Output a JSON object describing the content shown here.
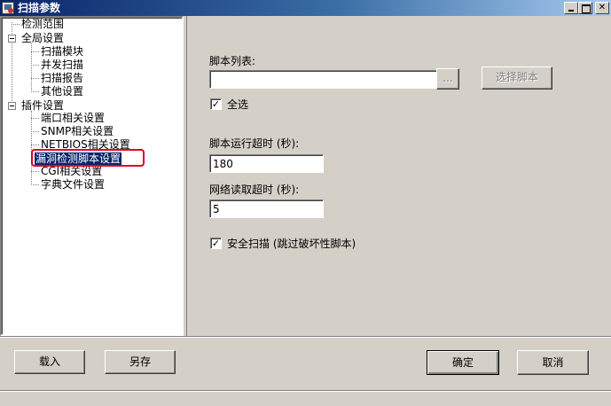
{
  "window": {
    "title": "扫描参数",
    "controls": [
      "minimize",
      "maximize",
      "close"
    ]
  },
  "tree": {
    "items": [
      {
        "label": "检测范围",
        "level": 0
      },
      {
        "label": "全局设置",
        "level": 0,
        "expanded": true
      },
      {
        "label": "扫描模块",
        "level": 1
      },
      {
        "label": "并发扫描",
        "level": 1
      },
      {
        "label": "扫描报告",
        "level": 1
      },
      {
        "label": "其他设置",
        "level": 1
      },
      {
        "label": "插件设置",
        "level": 0,
        "expanded": true
      },
      {
        "label": "端口相关设置",
        "level": 1
      },
      {
        "label": "SNMP相关设置",
        "level": 1
      },
      {
        "label": "NETBIOS相关设置",
        "level": 1
      },
      {
        "label": "漏洞检测脚本设置",
        "level": 1,
        "selected": true
      },
      {
        "label": "CGI相关设置",
        "level": 1
      },
      {
        "label": "字典文件设置",
        "level": 1
      }
    ]
  },
  "panel": {
    "script_list_label": "脚本列表:",
    "script_list_value": "",
    "browse_button": "...",
    "select_script_button": "选择脚本",
    "select_all_label": "全选",
    "select_all_checked": true,
    "script_timeout_label": "脚本运行超时 (秒):",
    "script_timeout_value": "180",
    "network_timeout_label": "网络读取超时 (秒):",
    "network_timeout_value": "5",
    "safe_scan_label": "安全扫描 (跳过破坏性脚本)",
    "safe_scan_checked": true
  },
  "footer": {
    "load_button": "载入",
    "save_as_button": "另存",
    "ok_button": "确定",
    "cancel_button": "取消"
  },
  "colors": {
    "selection": "#0a246a",
    "annotation_box": "#e0001a",
    "face": "#d4d0c8"
  }
}
